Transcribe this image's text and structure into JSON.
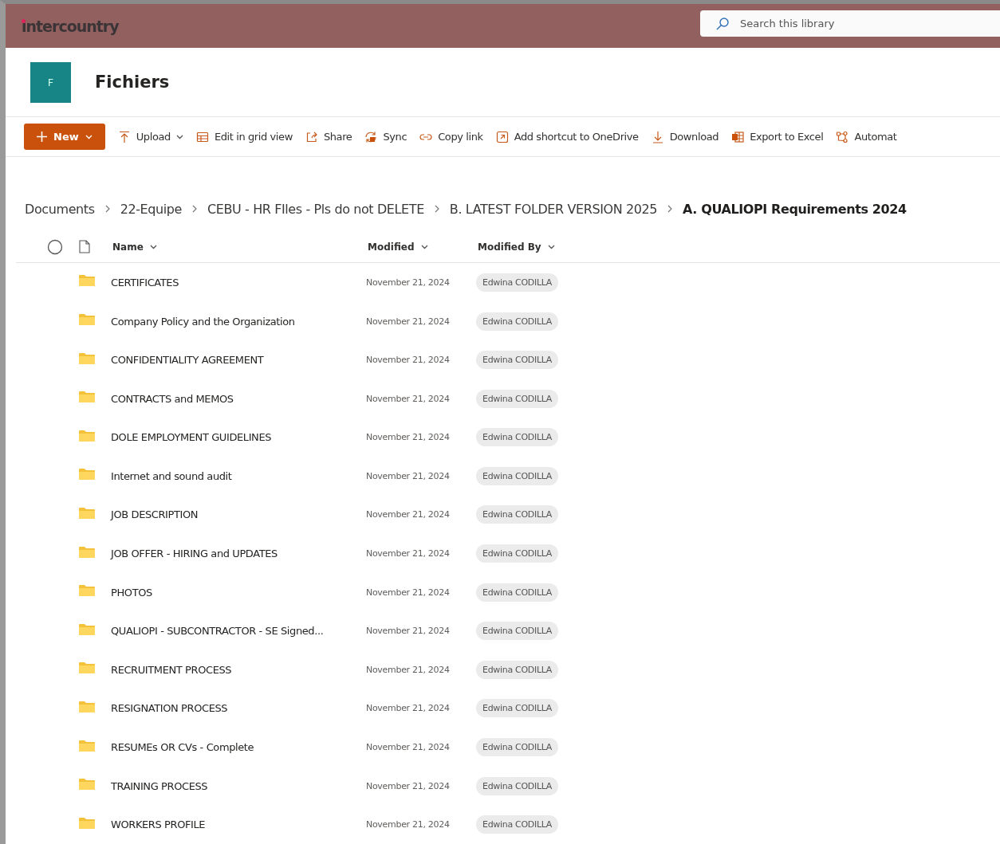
{
  "header": {
    "logo": "intercountry",
    "search": {
      "placeholder": "Search this library"
    }
  },
  "site": {
    "initial": "F",
    "title": "Fichiers"
  },
  "toolbar": [
    {
      "kind": "new",
      "label": "New"
    },
    {
      "kind": "upload",
      "label": "Upload"
    },
    {
      "kind": "grid",
      "label": "Edit in grid view"
    },
    {
      "kind": "share",
      "label": "Share"
    },
    {
      "kind": "sync",
      "label": "Sync"
    },
    {
      "kind": "link",
      "label": "Copy link"
    },
    {
      "kind": "shortcut",
      "label": "Add shortcut to OneDrive"
    },
    {
      "kind": "download",
      "label": "Download"
    },
    {
      "kind": "excel",
      "label": "Export to Excel"
    },
    {
      "kind": "automate",
      "label": "Automat"
    }
  ],
  "breadcrumb": [
    {
      "label": "Documents",
      "current": false
    },
    {
      "label": "22-Equipe",
      "current": false
    },
    {
      "label": "CEBU - HR FIles - Pls do not DELETE",
      "current": false
    },
    {
      "label": "B. LATEST FOLDER VERSION 2025",
      "current": false
    },
    {
      "label": "A. QUALIOPI Requirements 2024",
      "current": true
    }
  ],
  "table": {
    "columns": [
      "Name",
      "Modified",
      "Modified By"
    ],
    "rows": [
      {
        "name": "CERTIFICATES",
        "modified": "November 21, 2024",
        "modified_by": "Edwina CODILLA"
      },
      {
        "name": "Company Policy and the Organization",
        "modified": "November 21, 2024",
        "modified_by": "Edwina CODILLA"
      },
      {
        "name": "CONFIDENTIALITY AGREEMENT",
        "modified": "November 21, 2024",
        "modified_by": "Edwina CODILLA"
      },
      {
        "name": "CONTRACTS and MEMOS",
        "modified": "November 21, 2024",
        "modified_by": "Edwina CODILLA"
      },
      {
        "name": "DOLE EMPLOYMENT GUIDELINES",
        "modified": "November 21, 2024",
        "modified_by": "Edwina CODILLA"
      },
      {
        "name": "Internet and sound audit",
        "modified": "November 21, 2024",
        "modified_by": "Edwina CODILLA"
      },
      {
        "name": "JOB DESCRIPTION",
        "modified": "November 21, 2024",
        "modified_by": "Edwina CODILLA"
      },
      {
        "name": "JOB OFFER - HIRING and UPDATES",
        "modified": "November 21, 2024",
        "modified_by": "Edwina CODILLA"
      },
      {
        "name": "PHOTOS",
        "modified": "November 21, 2024",
        "modified_by": "Edwina CODILLA"
      },
      {
        "name": "QUALIOPI - SUBCONTRACTOR - SE Signed...",
        "modified": "November 21, 2024",
        "modified_by": "Edwina CODILLA"
      },
      {
        "name": "RECRUITMENT PROCESS",
        "modified": "November 21, 2024",
        "modified_by": "Edwina CODILLA"
      },
      {
        "name": "RESIGNATION PROCESS",
        "modified": "November 21, 2024",
        "modified_by": "Edwina CODILLA"
      },
      {
        "name": "RESUMEs OR CVs - Complete",
        "modified": "November 21, 2024",
        "modified_by": "Edwina CODILLA"
      },
      {
        "name": "TRAINING PROCESS",
        "modified": "November 21, 2024",
        "modified_by": "Edwina CODILLA"
      },
      {
        "name": "WORKERS PROFILE",
        "modified": "November 21, 2024",
        "modified_by": "Edwina CODILLA"
      }
    ]
  }
}
